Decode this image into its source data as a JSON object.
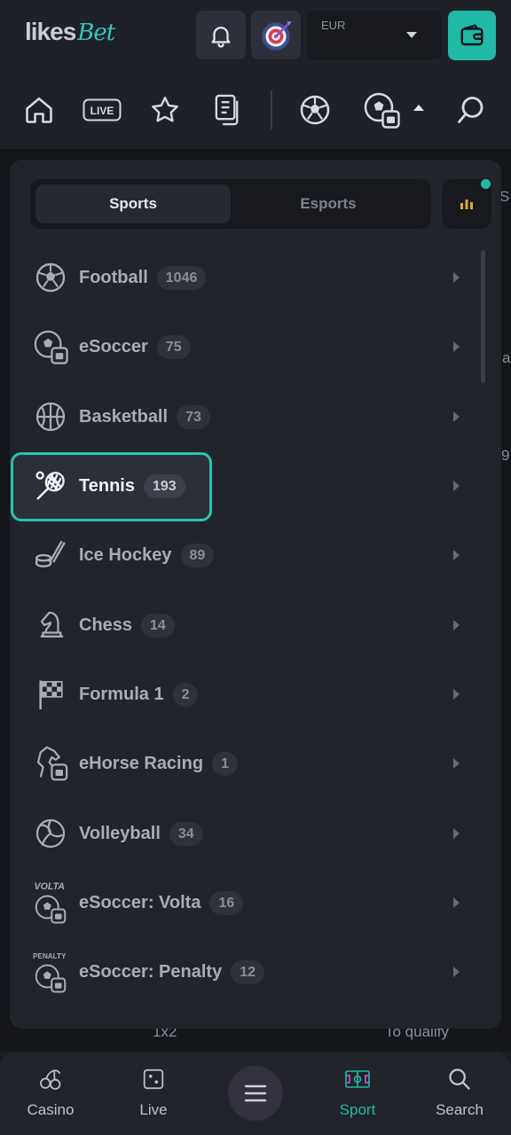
{
  "header": {
    "logo_part1": "likes",
    "logo_part2": "Bet",
    "currency_code": "EUR"
  },
  "nav": {
    "icons": [
      "home-icon",
      "live-icon",
      "star-icon",
      "betslip-icon",
      "football-icon",
      "esoccer-icon",
      "search-icon"
    ],
    "live_label": "LIVE"
  },
  "background": {
    "peek_1x2": "1x2",
    "peek_qualify": "To qualify",
    "peek_right_1": "S",
    "peek_right_2": "a",
    "peek_right_3": "9"
  },
  "panel": {
    "tabs": [
      {
        "label": "Sports",
        "active": true
      },
      {
        "label": "Esports",
        "active": false
      }
    ],
    "sports": [
      {
        "name": "Football",
        "count": "1046",
        "icon": "football-icon"
      },
      {
        "name": "eSoccer",
        "count": "75",
        "icon": "esoccer-icon"
      },
      {
        "name": "Basketball",
        "count": "73",
        "icon": "basketball-icon"
      },
      {
        "name": "Tennis",
        "count": "193",
        "icon": "tennis-icon",
        "highlighted": true
      },
      {
        "name": "Ice Hockey",
        "count": "89",
        "icon": "ice-hockey-icon"
      },
      {
        "name": "Chess",
        "count": "14",
        "icon": "chess-knight-icon"
      },
      {
        "name": "Formula 1",
        "count": "2",
        "icon": "checkered-flag-icon"
      },
      {
        "name": "eHorse Racing",
        "count": "1",
        "icon": "ehorse-icon"
      },
      {
        "name": "Volleyball",
        "count": "34",
        "icon": "volleyball-icon"
      },
      {
        "name": "eSoccer: Volta",
        "count": "16",
        "icon": "esoccer-volta-icon",
        "icon_label": "VOLTA"
      },
      {
        "name": "eSoccer: Penalty",
        "count": "12",
        "icon": "esoccer-penalty-icon",
        "icon_label": "PENALTY"
      }
    ]
  },
  "bottom_nav": {
    "items": [
      {
        "label": "Casino",
        "icon": "cherries-icon",
        "active": false
      },
      {
        "label": "Live",
        "icon": "dice-icon",
        "active": false
      },
      {
        "label": "Sport",
        "icon": "sport-field-icon",
        "active": true
      },
      {
        "label": "Search",
        "icon": "search-icon",
        "active": false
      }
    ],
    "menu_icon": "hamburger-icon"
  },
  "colors": {
    "accent": "#1fb9a6",
    "background": "#1b1d24",
    "panel": "#22242b"
  }
}
